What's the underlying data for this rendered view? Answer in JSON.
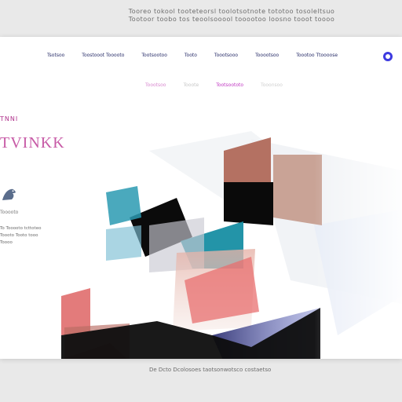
{
  "caption": {
    "top": "Tooreo tokool tooteteorsl toolotsotnote tototoo tosoleltsuo",
    "top2": "Tootoor toobo tos teoolsooool tooootoo loosno tooot toooo",
    "bottom": "De Dcto Dcolosoes taotsonwotsco costaetso"
  },
  "nav": {
    "items": [
      "Tsotsoo",
      "Toostooot Tooooto",
      "Tootsootoo",
      "Tooto",
      "Toootsooo",
      "Tooootsoo",
      "Toootoo Ttoooose"
    ]
  },
  "subnav": {
    "items": [
      "Toootsoo",
      "Tooote",
      "Tootsoototo",
      "Tooonsoo"
    ]
  },
  "hero": {
    "tag": "TNNI",
    "title": "TVINKK",
    "mini_label": "Tooooto",
    "desc_line1": "To Tooooto tcttoteo",
    "desc_line2": "Toooto Tooto tooo",
    "desc_line3": "Toooo"
  },
  "colors": {
    "accent": "#3d3ae0",
    "title": "#c75aa6",
    "teal": "#1b8aa0",
    "navy": "#161e55",
    "salmon": "#e07a7a",
    "brown": "#9c6b58",
    "black": "#0b0b0b"
  }
}
